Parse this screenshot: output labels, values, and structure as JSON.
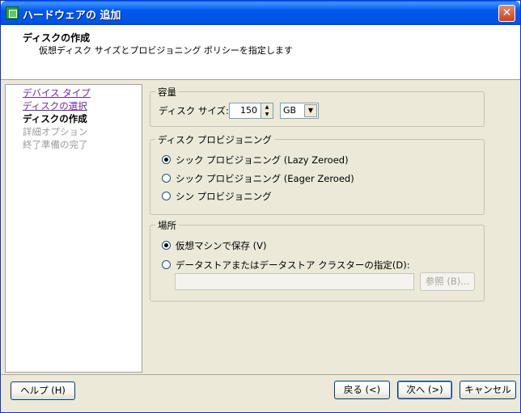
{
  "window": {
    "title": "ハードウェアの 追加",
    "close_glyph": "✕"
  },
  "header": {
    "title": "ディスクの作成",
    "subtitle": "仮想ディスク サイズとプロビジョニング ポリシーを指定します"
  },
  "nav": {
    "items": [
      {
        "label": "デバイス タイプ",
        "state": "link"
      },
      {
        "label": "ディスクの選択",
        "state": "link"
      },
      {
        "label": "ディスクの作成",
        "state": "current"
      },
      {
        "label": "詳細オプション",
        "state": "disabled"
      },
      {
        "label": "終了準備の完了",
        "state": "disabled"
      }
    ]
  },
  "capacity": {
    "legend": "容量",
    "disk_size_label": "ディスク サイズ:",
    "disk_size_value": "150",
    "unit_value": "GB",
    "spin_up": "▲",
    "spin_down": "▼",
    "dropdown_arrow": "▼"
  },
  "provisioning": {
    "legend": "ディスク プロビジョニング",
    "options": [
      {
        "label": "シック プロビジョニング (Lazy Zeroed)",
        "checked": true
      },
      {
        "label": "シック プロビジョニング (Eager Zeroed)",
        "checked": false
      },
      {
        "label": "シン プロビジョニング",
        "checked": false
      }
    ]
  },
  "location": {
    "legend": "場所",
    "options": [
      {
        "label": "仮想マシンで保存 (V)",
        "checked": true
      },
      {
        "label": "データストアまたはデータストア クラスターの指定(D):",
        "checked": false
      }
    ],
    "datastore_path": "",
    "browse_label": "参照 (B)..."
  },
  "footer": {
    "help_label": "ヘルプ (H)",
    "back_label": "戻る (<)",
    "next_label": "次へ (>)",
    "cancel_label": "キャンセル"
  },
  "colors": {
    "titlebar": "#0054e3",
    "link": "#6b2a9e",
    "disabled": "#9c9c9c",
    "panel_bg": "#ece9d8"
  }
}
